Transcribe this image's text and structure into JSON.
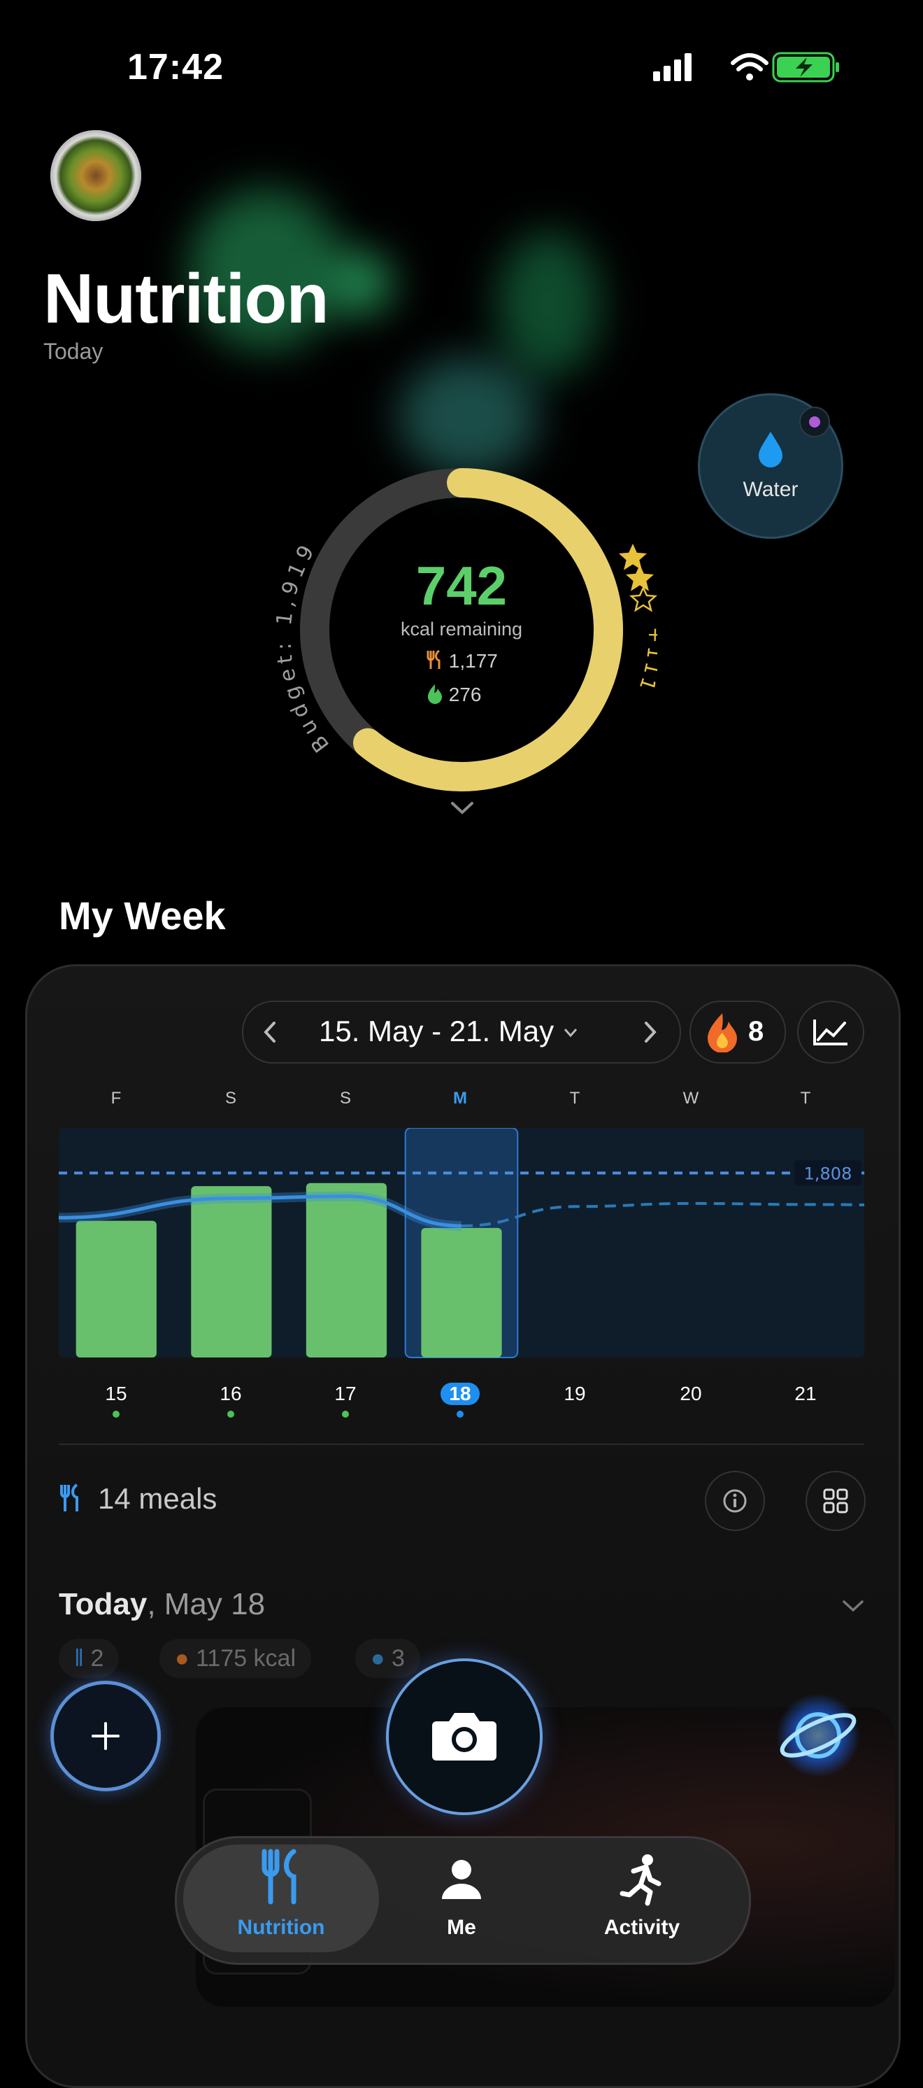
{
  "status": {
    "time": "17:42"
  },
  "header": {
    "title": "Nutrition",
    "subtitle": "Today"
  },
  "water": {
    "label": "Water"
  },
  "ring": {
    "remaining": "742",
    "remaining_label": "kcal remaining",
    "eaten": "1,177",
    "burned": "276",
    "budget_label": "Budget: 1,919",
    "bonus_label": "+111",
    "progress": 0.61
  },
  "week": {
    "title": "My Week",
    "range": "15. May - 21. May",
    "streak": "8",
    "day_letters": [
      "F",
      "S",
      "S",
      "M",
      "T",
      "W",
      "T"
    ],
    "day_numbers": [
      "15",
      "16",
      "17",
      "18",
      "19",
      "20",
      "21"
    ],
    "selected_index": 3,
    "goal_label": "1,808",
    "meals": "14 meals",
    "today_label": "Today",
    "today_date": ", May 18",
    "chips": [
      "2",
      "1175 kcal",
      "3"
    ]
  },
  "chart_data": {
    "type": "bar",
    "categories": [
      "15",
      "16",
      "17",
      "18",
      "19",
      "20",
      "21"
    ],
    "values": [
      1340,
      1680,
      1710,
      1270,
      0,
      0,
      0
    ],
    "goal": 1808,
    "trend_actual": [
      1370,
      1560,
      1580,
      1290
    ],
    "trend_projected": [
      1290,
      1480,
      1510,
      1500,
      1490
    ],
    "ylim": [
      0,
      2250
    ],
    "colors": {
      "bar": "#68c06c",
      "goal": "#4d8ee0",
      "trend": "#3a8fe0"
    }
  },
  "tabbar": {
    "items": [
      {
        "label": "Nutrition",
        "icon": "fork-knife-icon",
        "active": true
      },
      {
        "label": "Me",
        "icon": "person-icon",
        "active": false
      },
      {
        "label": "Activity",
        "icon": "running-icon",
        "active": false
      }
    ]
  },
  "colors": {
    "accent": "#3a9bf0",
    "ring": "#e8d16c",
    "remaining": "#5ccf6a"
  }
}
